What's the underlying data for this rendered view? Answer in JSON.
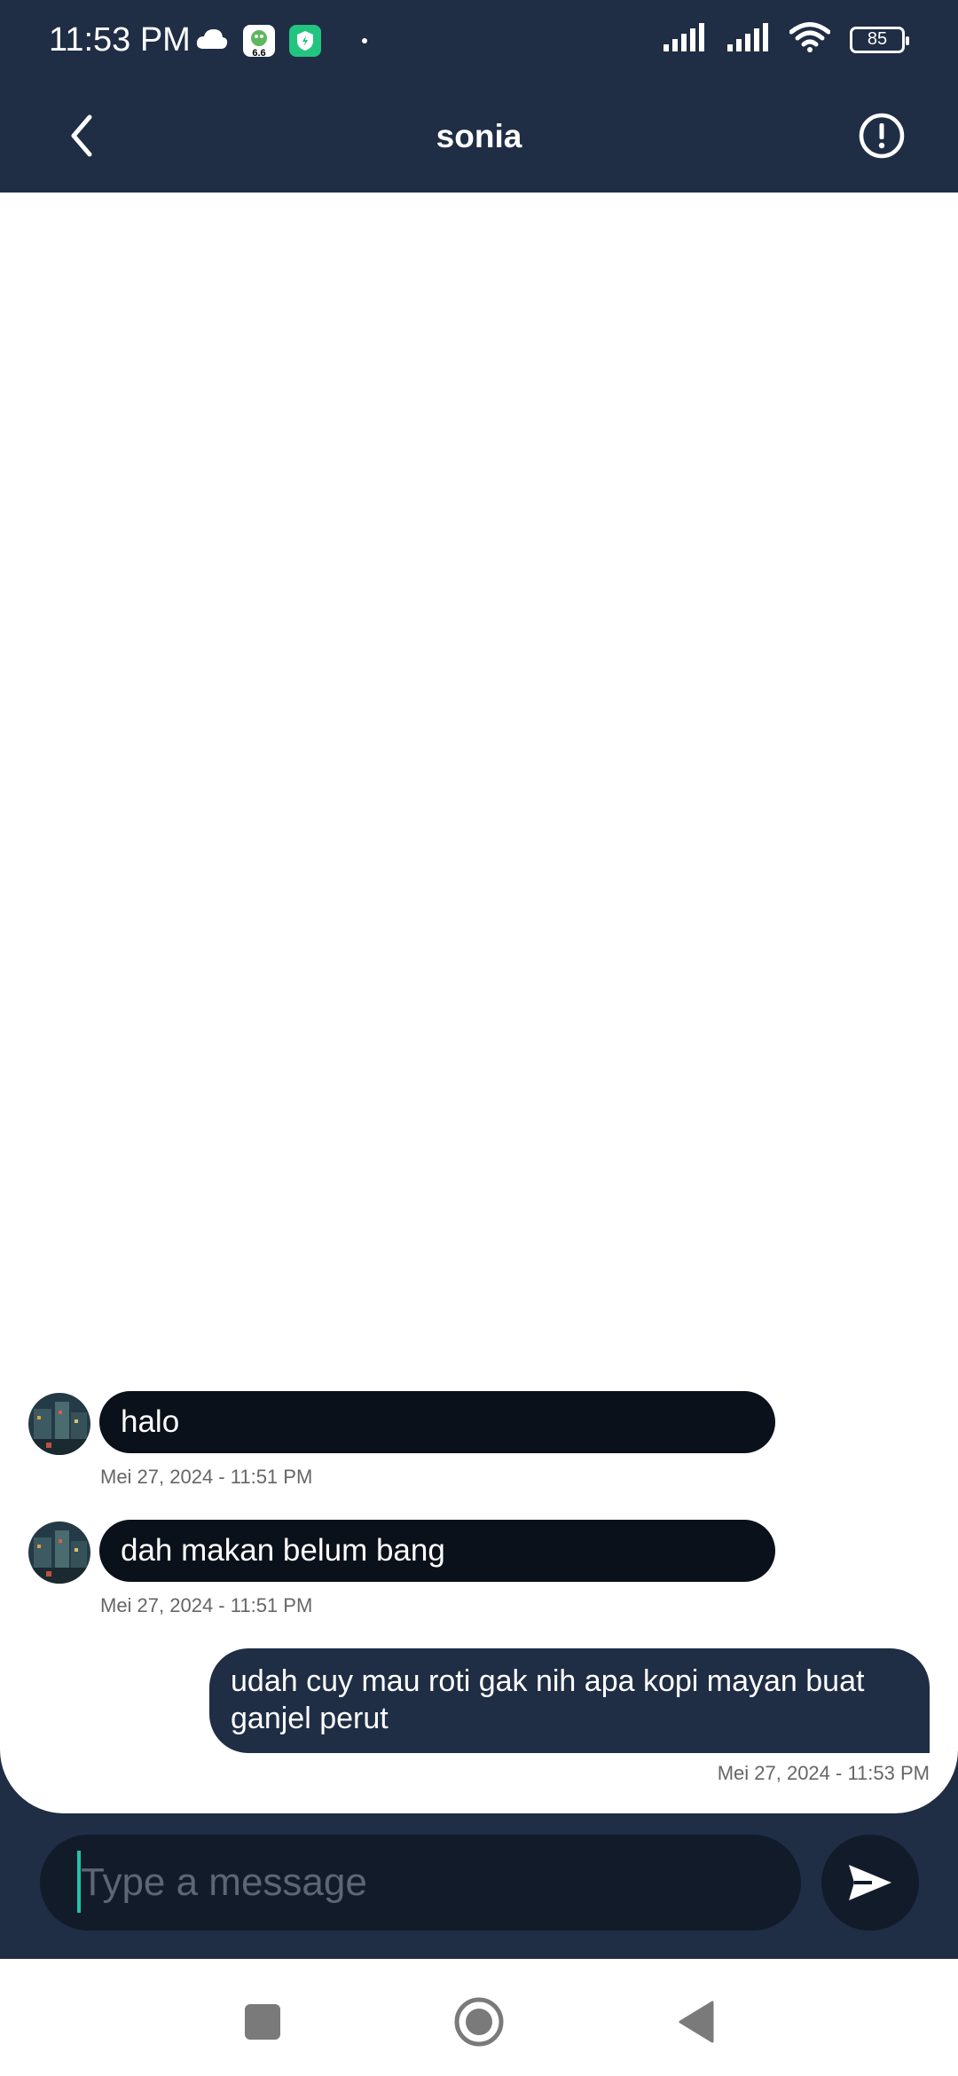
{
  "status_bar": {
    "time": "11:53 PM",
    "app_badge_text": "6.6",
    "battery_level": "85",
    "icons": [
      "cloud-icon",
      "app-notification-icon",
      "shield-app-icon",
      "dot-icon",
      "signal-icon",
      "signal-icon",
      "wifi-icon",
      "battery-icon"
    ]
  },
  "header": {
    "title": "sonia",
    "back_icon": "chevron-left-icon",
    "info_icon": "exclamation-circle-icon"
  },
  "messages": [
    {
      "direction": "incoming",
      "text": "halo",
      "timestamp": "Mei 27, 2024 - 11:51 PM"
    },
    {
      "direction": "incoming",
      "text": "dah makan belum bang",
      "timestamp": "Mei 27, 2024 - 11:51 PM"
    },
    {
      "direction": "outgoing",
      "text": "udah cuy mau roti gak nih apa kopi mayan buat ganjel perut",
      "timestamp": "Mei 27, 2024 - 11:53 PM"
    }
  ],
  "composer": {
    "placeholder": "Type a message",
    "value": "",
    "send_icon": "send-icon"
  },
  "nav_bar": {
    "icons": [
      "recents-square-icon",
      "home-circle-icon",
      "back-triangle-icon"
    ]
  },
  "colors": {
    "primary": "#1f2d45",
    "incoming_bubble": "#0b111b",
    "composer_bg": "#121b2a",
    "caret": "#20c4a8",
    "timestamp": "#666666"
  }
}
